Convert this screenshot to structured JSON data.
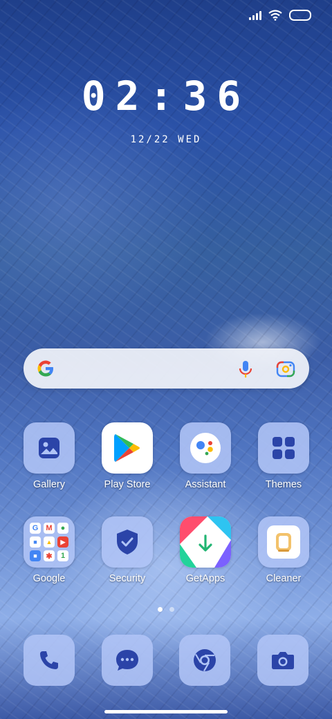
{
  "status_bar": {
    "icons": [
      "signal-icon",
      "wifi-icon",
      "battery-icon"
    ]
  },
  "clock": {
    "time": "02:36",
    "date": "12/22 WED"
  },
  "search_widget": {
    "icons": [
      "google-g-icon",
      "microphone-icon",
      "google-lens-icon"
    ]
  },
  "apps": [
    {
      "label": "Gallery",
      "icon": "gallery-icon"
    },
    {
      "label": "Play Store",
      "icon": "play-store-icon"
    },
    {
      "label": "Assistant",
      "icon": "assistant-icon"
    },
    {
      "label": "Themes",
      "icon": "themes-icon"
    },
    {
      "label": "Google",
      "icon": "google-folder-icon"
    },
    {
      "label": "Security",
      "icon": "security-shield-icon"
    },
    {
      "label": "GetApps",
      "icon": "getapps-icon"
    },
    {
      "label": "Cleaner",
      "icon": "cleaner-icon"
    }
  ],
  "page_indicator": {
    "pages": 2,
    "current": 1
  },
  "dock": [
    {
      "icon": "phone-icon"
    },
    {
      "icon": "messages-icon"
    },
    {
      "icon": "chrome-browser-icon"
    },
    {
      "icon": "camera-icon"
    }
  ],
  "colors": {
    "tile": "#b0c4f6",
    "icon_dark": "#2b44a8",
    "accent_blue": "#4285f4",
    "red": "#ea4335",
    "yellow": "#fbbc05",
    "green": "#34a853"
  }
}
